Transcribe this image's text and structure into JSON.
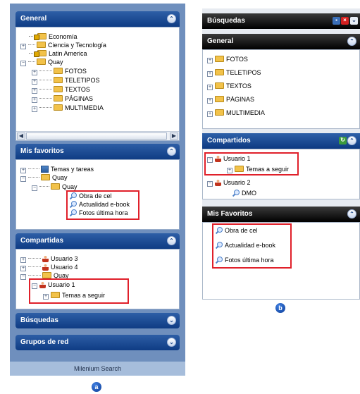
{
  "panel_a": {
    "general": {
      "title": "General",
      "items": [
        "Economía",
        "Ciencia y Tecnología",
        "Latin America",
        "Quay",
        "FOTOS",
        "TELETIPOS",
        "TEXTOS",
        "PÁGINAS",
        "MULTIMEDIA"
      ]
    },
    "favoritos": {
      "title": "Mis favoritos",
      "items": [
        "Temas y tareas",
        "Quay",
        "Quay",
        "Obra de cel",
        "Actualidad e-book",
        "Fotos última hora"
      ]
    },
    "compartidas": {
      "title": "Compartidas",
      "items": [
        "Usuario 3",
        "Usuario 4",
        "Quay",
        "Usuario 1",
        "Temas a seguir"
      ]
    },
    "busquedas": {
      "title": "Búsquedas"
    },
    "grupos": {
      "title": "Grupos de red"
    },
    "footer": "Milenium Search",
    "label": "a"
  },
  "panel_b": {
    "header": "Búsquedas",
    "general": {
      "title": "General",
      "items": [
        "FOTOS",
        "TELETIPOS",
        "TEXTOS",
        "PÁGINAS",
        "MULTIMEDIA"
      ]
    },
    "compartidos": {
      "title": "Compartidos",
      "items": [
        "Usuario 1",
        "Temas a seguir",
        "Usuario 2",
        "DMO"
      ]
    },
    "favoritos": {
      "title": "Mis Favoritos",
      "items": [
        "Obra de cel",
        "Actualidad e-book",
        "Fotos última hora"
      ]
    },
    "label": "b"
  },
  "colors": {
    "panel_blue": "#6f8fbd",
    "header_blue": "#0f3c84",
    "highlight_red": "#e0202a",
    "folder_yellow": "#f2c24a"
  }
}
